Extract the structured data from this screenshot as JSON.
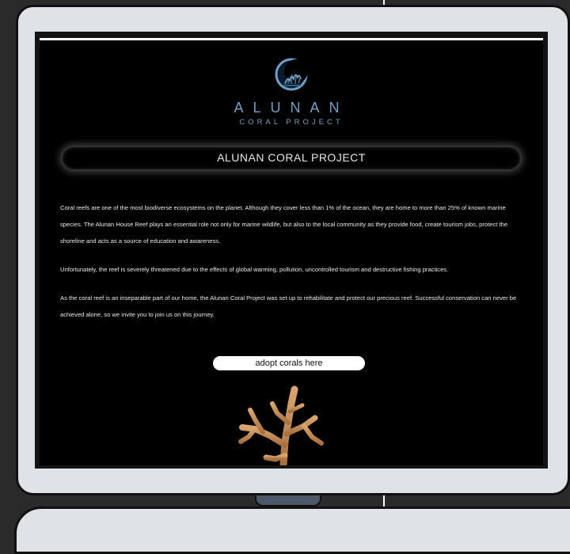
{
  "brand": {
    "name": "ALUNAN",
    "subtitle": "CORAL PROJECT"
  },
  "banner": {
    "title": "ALUNAN CORAL PROJECT"
  },
  "paragraphs": [
    "Coral reefs are one of the most biodiverse ecosystems on the planet. Although they cover less than 1% of the ocean, they are home to more than 25% of known marine species. The Alunan House Reef plays an essential role not only for marine wildlife, but also to the local community as they provide food, create tourism jobs, protect the shoreline and acts as a source of education and awareness.",
    "Unfortunately, the reef is severely threatened due to the effects of global warming, pollution, uncontrolled tourism and destructive fishing practices.",
    "As the coral reef is an inseparable part of our home, the Alunan Coral Project was set up to rehabilitate and protect our precious reef. Successful conservation can never be achieved alone, so we invite you to join us on this journey."
  ],
  "cta": {
    "label": "adopt corals here"
  },
  "colors": {
    "brand": "#6f9fc4",
    "page_bg": "#000000",
    "frame": "#dfe2e6",
    "coral": "#c8915a"
  },
  "icons": {
    "logo": "alunan-logo-icon",
    "coral": "coral-image"
  }
}
